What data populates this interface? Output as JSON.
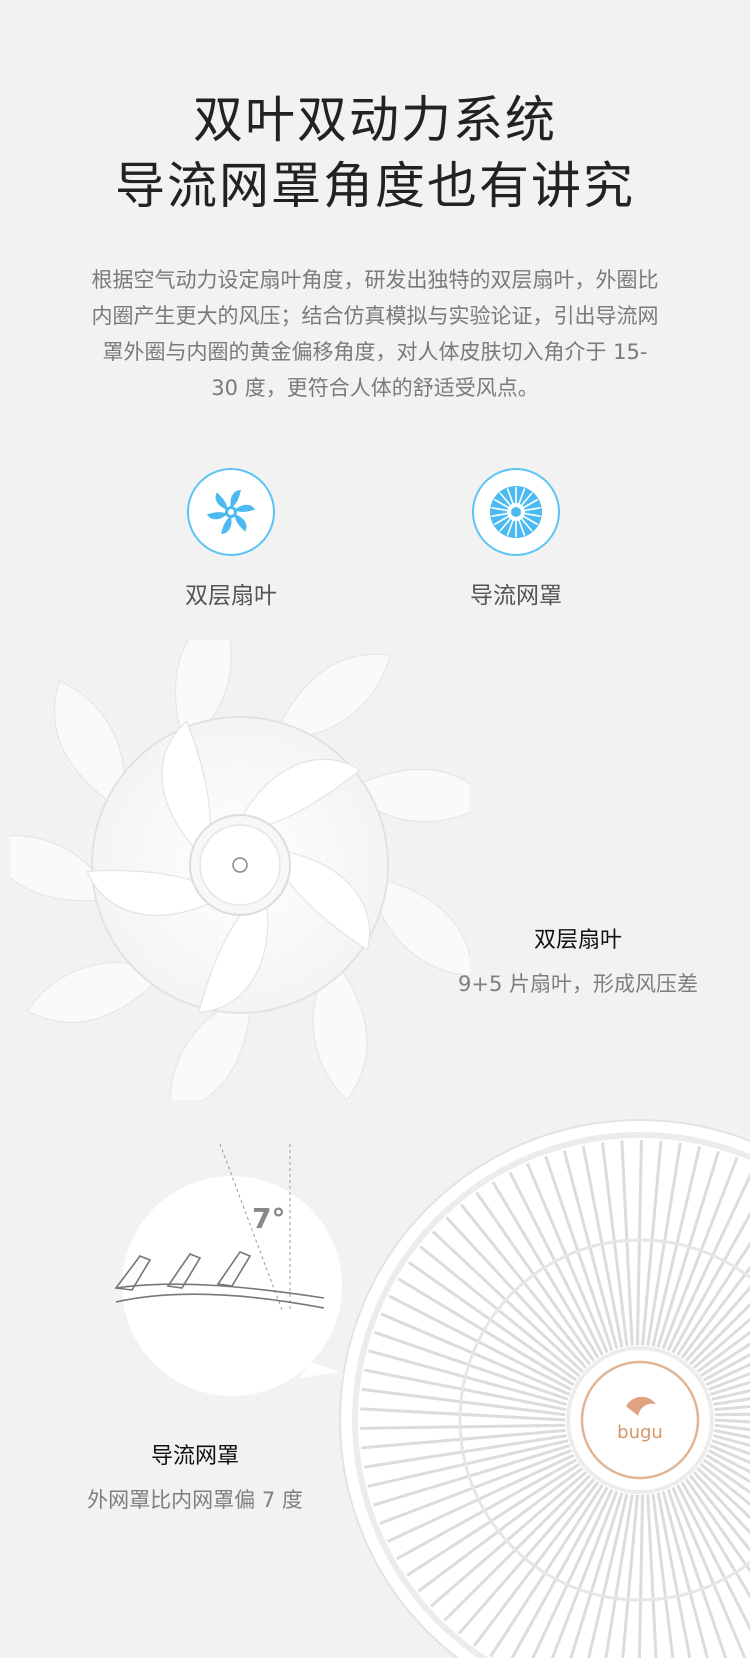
{
  "header": {
    "title_line1": "双叶双动力系统",
    "title_line2": "导流网罩角度也有讲究",
    "description": "根据空气动力设定扇叶角度，研发出独特的双层扇叶，外圈比内圈产生更大的风压；结合仿真模拟与实验论证，引出导流网罩外圈与内圈的黄金偏移角度，对人体皮肤切入角介于 15-30 度，更符合人体的舒适受风点。"
  },
  "features": [
    {
      "label": "双层扇叶",
      "icon": "fan-blade-icon"
    },
    {
      "label": "导流网罩",
      "icon": "guard-grille-icon"
    }
  ],
  "blade_section": {
    "title": "双层扇叶",
    "subtitle": "9+5 片扇叶，形成风压差"
  },
  "guard_section": {
    "title": "导流网罩",
    "subtitle": "外网罩比内网罩偏 7 度",
    "angle_label": "7°",
    "brand": "bugu"
  },
  "colors": {
    "accent": "#5cc3f4",
    "background": "#f2f2f2",
    "brand": "#d9956b"
  }
}
